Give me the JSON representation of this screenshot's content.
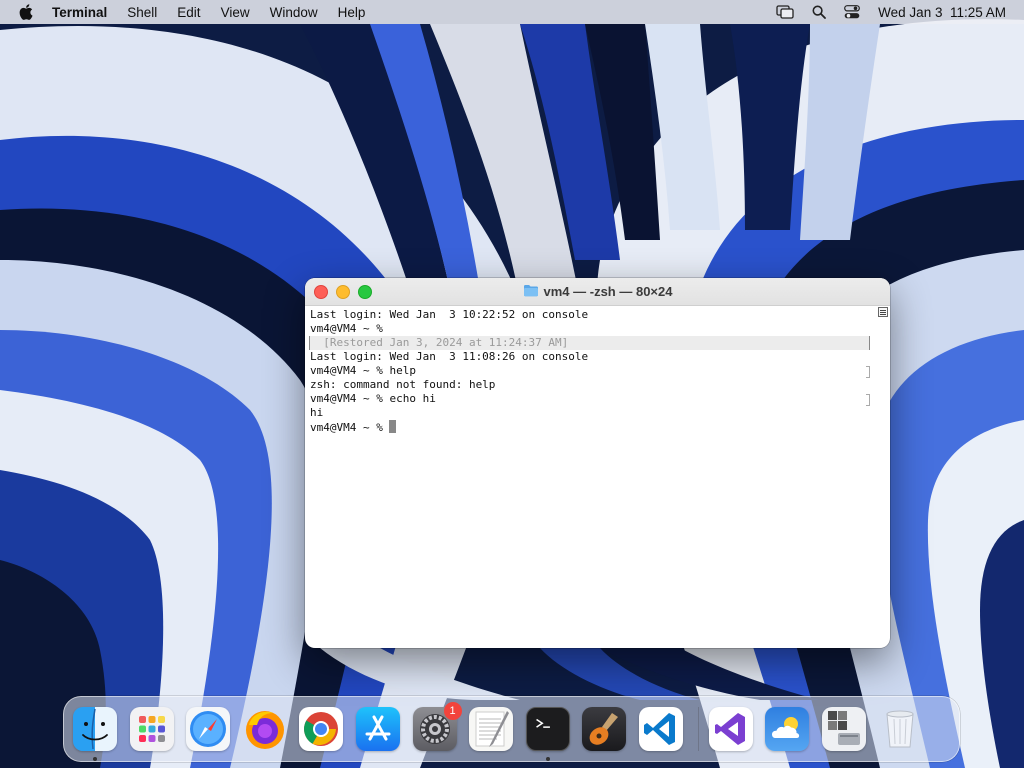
{
  "menubar": {
    "app_name": "Terminal",
    "items": [
      "Shell",
      "Edit",
      "View",
      "Window",
      "Help"
    ],
    "clock": "Wed Jan 3  11:25 AM"
  },
  "window": {
    "title": "vm4 — -zsh — 80×24",
    "lines": [
      {
        "text": "Last login: Wed Jan  3 10:22:52 on console",
        "kind": "normal"
      },
      {
        "text": "vm4@VM4 ~ %",
        "kind": "normal"
      },
      {
        "text": "  [Restored Jan 3, 2024 at 11:24:37 AM]",
        "kind": "restored"
      },
      {
        "text": "Last login: Wed Jan  3 11:08:26 on console",
        "kind": "normal"
      },
      {
        "text": "vm4@VM4 ~ % help",
        "kind": "marked"
      },
      {
        "text": "zsh: command not found: help",
        "kind": "normal"
      },
      {
        "text": "vm4@VM4 ~ % echo hi",
        "kind": "marked"
      },
      {
        "text": "hi",
        "kind": "normal"
      },
      {
        "text": "vm4@VM4 ~ % ",
        "kind": "prompt"
      }
    ]
  },
  "dock": {
    "apps": [
      {
        "name": "finder",
        "running": true
      },
      {
        "name": "launchpad",
        "running": false
      },
      {
        "name": "safari",
        "running": false
      },
      {
        "name": "firefox",
        "running": false
      },
      {
        "name": "chrome",
        "running": false
      },
      {
        "name": "app-store",
        "running": false
      },
      {
        "name": "system-settings",
        "running": false,
        "badge": "1"
      },
      {
        "name": "textedit",
        "running": false
      },
      {
        "name": "terminal",
        "running": true
      },
      {
        "name": "garageband",
        "running": false
      },
      {
        "name": "vscode",
        "running": false
      }
    ],
    "others": [
      {
        "name": "visual-studio"
      },
      {
        "name": "weather"
      },
      {
        "name": "boot-camp"
      },
      {
        "name": "trash"
      }
    ]
  }
}
